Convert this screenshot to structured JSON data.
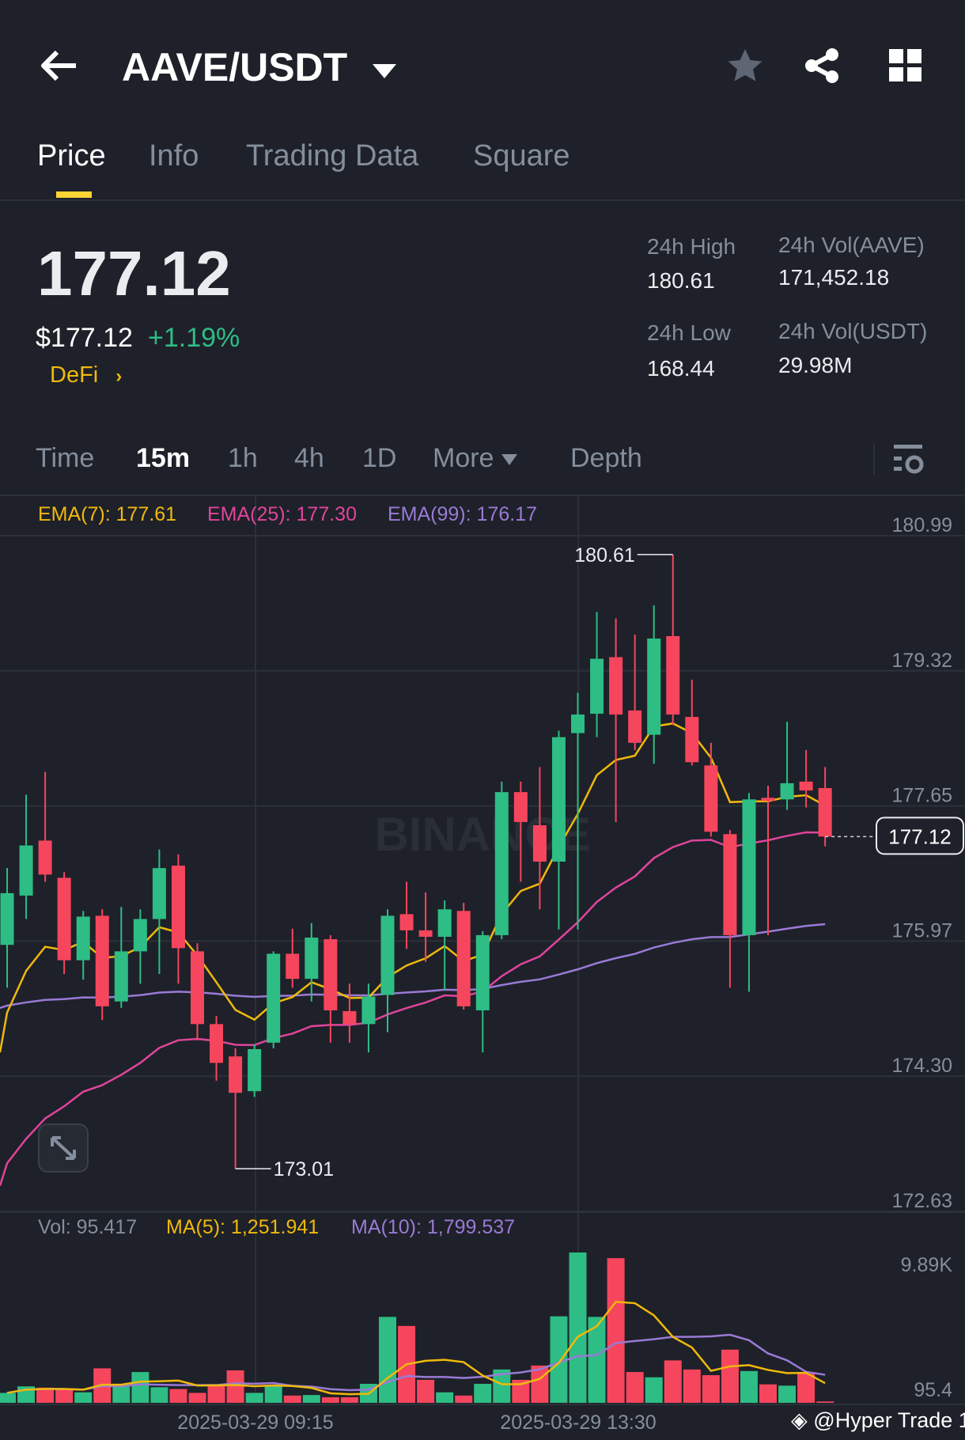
{
  "header": {
    "title": "AAVE/USDT"
  },
  "tabs": [
    "Price",
    "Info",
    "Trading Data",
    "Square"
  ],
  "ticker": {
    "last_price": "177.12",
    "usd_price": "$177.12",
    "change": "+1.19%",
    "category": "DeFi",
    "high_label": "24h High",
    "high": "180.61",
    "low_label": "24h Low",
    "low": "168.44",
    "vol_base_label": "24h Vol(AAVE)",
    "vol_base": "171,452.18",
    "vol_quote_label": "24h Vol(USDT)",
    "vol_quote": "29.98M"
  },
  "timeframes": {
    "time": "Time",
    "m15": "15m",
    "h1": "1h",
    "h4": "4h",
    "d1": "1D",
    "more": "More",
    "depth": "Depth"
  },
  "legend": {
    "ema7": "EMA(7): 177.61",
    "ema25": "EMA(25): 177.30",
    "ema99": "EMA(99): 176.17",
    "vol": "Vol: 95.417",
    "ma5": "MA(5): 1,251.941",
    "ma10": "MA(10): 1,799.537"
  },
  "colors": {
    "up": "#2ebd85",
    "down": "#f6465d",
    "ema7": "#f0b90b",
    "ema25": "#e0449c",
    "ema99": "#9a7ad6",
    "accent": "#fcd535"
  },
  "watermark": "BINANCE",
  "credit": "@Hyper Trade 1",
  "chart_data": {
    "type": "candlestick",
    "price_axis": [
      "180.99",
      "179.32",
      "177.65",
      "175.97",
      "174.30",
      "172.63"
    ],
    "ylim": [
      172.63,
      180.99
    ],
    "vol_axis": [
      "9.89K",
      "95.4"
    ],
    "x_labels": [
      "2025-03-29 09:15",
      "2025-03-29 13:30"
    ],
    "high_marker": "180.61",
    "low_marker": "173.01",
    "current_price": "177.12",
    "ema_seed": {
      "ema7": 174.45,
      "ema25": 172.8,
      "ema99": 175.0
    },
    "candles": [
      [
        175.78,
        176.73,
        175.25,
        176.42
      ],
      [
        176.39,
        177.64,
        176.1,
        177.01
      ],
      [
        177.07,
        177.92,
        176.56,
        176.65
      ],
      [
        176.61,
        176.68,
        175.42,
        175.59
      ],
      [
        175.59,
        176.2,
        175.35,
        176.13
      ],
      [
        176.14,
        176.22,
        174.85,
        175.02
      ],
      [
        175.08,
        176.25,
        175.0,
        175.7
      ],
      [
        175.7,
        176.22,
        175.3,
        176.1
      ],
      [
        176.1,
        176.96,
        175.42,
        176.73
      ],
      [
        176.76,
        176.9,
        175.3,
        175.74
      ],
      [
        175.7,
        175.8,
        174.6,
        174.8
      ],
      [
        174.8,
        174.9,
        174.1,
        174.32
      ],
      [
        174.4,
        174.5,
        173.01,
        173.95
      ],
      [
        173.97,
        174.55,
        173.9,
        174.49
      ],
      [
        174.57,
        175.7,
        174.5,
        175.67
      ],
      [
        175.67,
        175.98,
        175.25,
        175.36
      ],
      [
        175.36,
        176.05,
        175.08,
        175.87
      ],
      [
        175.85,
        175.9,
        174.57,
        174.97
      ],
      [
        174.96,
        175.3,
        174.57,
        174.8
      ],
      [
        174.8,
        175.3,
        174.45,
        175.14
      ],
      [
        175.16,
        176.22,
        174.7,
        176.14
      ],
      [
        176.16,
        176.56,
        175.73,
        175.96
      ],
      [
        175.96,
        176.43,
        175.57,
        175.88
      ],
      [
        175.88,
        176.33,
        175.22,
        176.22
      ],
      [
        176.2,
        176.3,
        174.98,
        175.02
      ],
      [
        174.97,
        175.95,
        174.45,
        175.9
      ],
      [
        175.9,
        177.8,
        175.85,
        177.67
      ],
      [
        177.67,
        177.8,
        176.56,
        177.3
      ],
      [
        177.26,
        177.98,
        176.22,
        176.81
      ],
      [
        176.81,
        178.43,
        175.97,
        178.35
      ],
      [
        178.4,
        178.9,
        175.97,
        178.63
      ],
      [
        178.64,
        179.9,
        178.35,
        179.32
      ],
      [
        179.34,
        179.82,
        177.3,
        178.63
      ],
      [
        178.68,
        179.62,
        178.19,
        178.28
      ],
      [
        178.38,
        179.98,
        178.02,
        179.57
      ],
      [
        179.6,
        180.61,
        178.5,
        178.63
      ],
      [
        178.6,
        179.06,
        178.0,
        178.04
      ],
      [
        178.0,
        178.28,
        177.12,
        177.18
      ],
      [
        177.15,
        177.2,
        175.25,
        175.9
      ],
      [
        175.9,
        177.66,
        175.2,
        177.58
      ],
      [
        177.6,
        177.75,
        175.9,
        177.56
      ],
      [
        177.58,
        178.54,
        177.45,
        177.78
      ],
      [
        177.8,
        178.19,
        177.48,
        177.69
      ],
      [
        177.72,
        177.98,
        177.0,
        177.12
      ]
    ],
    "volumes": [
      0.7,
      1.16,
      1.07,
      0.97,
      0.74,
      2.43,
      1.16,
      2.17,
      1.1,
      0.97,
      0.7,
      1.21,
      2.29,
      0.7,
      1.21,
      0.51,
      0.55,
      0.39,
      0.39,
      1.34,
      6.06,
      5.42,
      1.62,
      0.74,
      0.51,
      1.34,
      2.35,
      1.62,
      2.63,
      6.1,
      10.6,
      6.06,
      10.2,
      2.17,
      1.8,
      2.99,
      2.35,
      1.95,
      3.75,
      2.24,
      1.3,
      1.21,
      2.08,
      0.095
    ]
  }
}
